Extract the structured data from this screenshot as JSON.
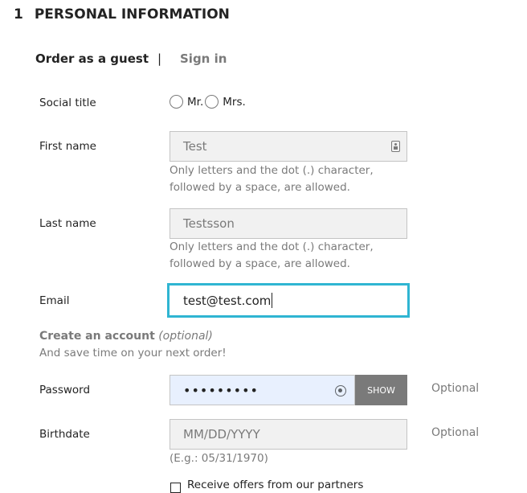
{
  "section": {
    "number": "1",
    "title": "PERSONAL INFORMATION"
  },
  "tabs": {
    "guest": "Order as a guest",
    "separator": "|",
    "signin": "Sign in"
  },
  "social_title": {
    "label": "Social title",
    "options": [
      "Mr.",
      "Mrs."
    ]
  },
  "first_name": {
    "label": "First name",
    "value": "Test",
    "hint_line1": "Only letters and the dot (.) character,",
    "hint_line2": "followed by a space, are allowed."
  },
  "last_name": {
    "label": "Last name",
    "value": "Testsson",
    "hint_line1": "Only letters and the dot (.) character,",
    "hint_line2": "followed by a space, are allowed."
  },
  "email": {
    "label": "Email",
    "value": "test@test.com"
  },
  "create_account": {
    "title": "Create an account",
    "optional": "(optional)",
    "subtitle": "And save time on your next order!"
  },
  "password": {
    "label": "Password",
    "value": "•••••••••",
    "show_label": "SHOW",
    "optional": "Optional"
  },
  "birthdate": {
    "label": "Birthdate",
    "placeholder": "MM/DD/YYYY",
    "example": "(E.g.: 05/31/1970)",
    "optional": "Optional"
  },
  "offers": {
    "label": "Receive offers from our partners"
  },
  "colors": {
    "accent": "#2fb5d2",
    "autofill": "#e8f0fe",
    "muted": "#7a7a7a"
  }
}
